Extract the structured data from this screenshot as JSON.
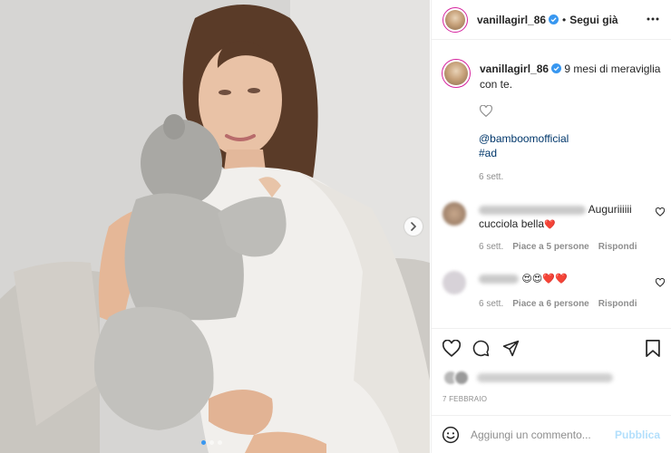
{
  "post": {
    "author": "vanillagirl_86",
    "follow_label": "Segui già",
    "separator": "•",
    "caption_text": "9 mesi di meraviglia con te.",
    "tags": [
      "@bamboomofficial",
      "#ad"
    ],
    "caption_time": "6 sett.",
    "date": "7 FEBBRAIO"
  },
  "comments": [
    {
      "text": "Auguriiiiii cucciola bella",
      "emoji": "❤️",
      "time": "6 sett.",
      "likes": "Piace a 5 persone",
      "reply": "Rispondi"
    },
    {
      "emoji": "😍😍❤️❤️",
      "time": "6 sett.",
      "likes": "Piace a 6 persone",
      "reply": "Rispondi"
    }
  ],
  "comment_box": {
    "placeholder": "Aggiungi un commento...",
    "publish_label": "Pubblica"
  },
  "icons": {
    "verified": "verified-badge-icon",
    "more": "more-options-icon",
    "like": "heart-icon",
    "comment": "comment-icon",
    "share": "share-icon",
    "save": "bookmark-icon",
    "emoji": "emoji-icon",
    "next": "chevron-right-icon"
  },
  "colors": {
    "verified_blue": "#3897f0",
    "link": "#00376b",
    "muted": "#8e8e8e",
    "publish_disabled": "#b2dffc",
    "heart_red": "#e0245e"
  }
}
